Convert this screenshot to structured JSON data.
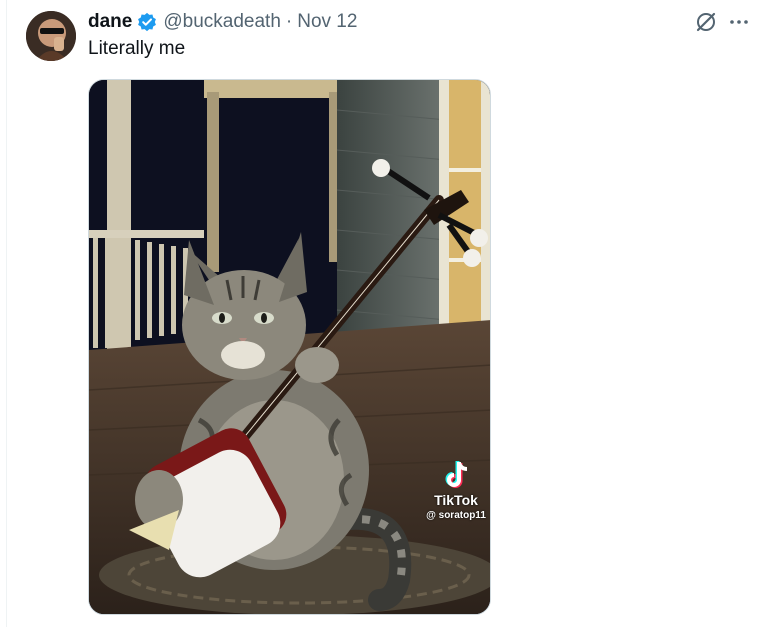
{
  "tweet": {
    "author_name": "dane",
    "author_handle": "@buckadeath",
    "separator": "·",
    "date": "Nov 12",
    "text": "Literally me",
    "verified_color": "#1d9bf0"
  },
  "media": {
    "watermark_brand": "TikTok",
    "watermark_user": "@ soratop11",
    "description_icon": "cat-playing-shamisen-image"
  },
  "icons": {
    "grok": "grok-icon",
    "more": "more-icon",
    "verified": "verified-badge-icon"
  }
}
